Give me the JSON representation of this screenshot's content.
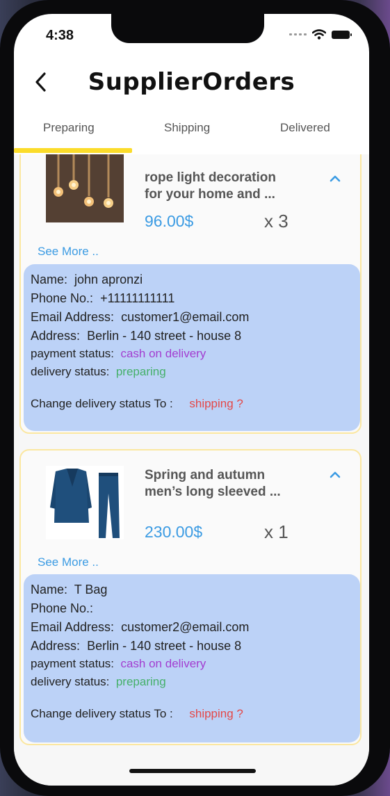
{
  "status_bar": {
    "time": "4:38"
  },
  "header": {
    "title": "SupplierOrders"
  },
  "tabs": [
    {
      "label": "Preparing",
      "active": true
    },
    {
      "label": "Shipping",
      "active": false
    },
    {
      "label": "Delivered",
      "active": false
    }
  ],
  "orders": [
    {
      "product_name": "rope light decoration for your home and ...",
      "name_line1": "rope light decoration",
      "name_line2": "for your home and ...",
      "price": "96.00$",
      "quantity": "x 3",
      "see_more": "See More ..",
      "customer_name_label": "Name:",
      "customer_name": "john apronzi",
      "phone_label": "Phone No.:",
      "phone": "+11111111111",
      "email_label": "Email Address:",
      "email": "customer1@email.com",
      "address_label": "Address:",
      "address": "Berlin - 140 street - house 8",
      "payment_label": "payment status:",
      "payment_status": "cash on delivery",
      "delivery_label": "delivery status:",
      "delivery_status": "preparing",
      "change_label": "Change delivery status To :",
      "change_action": "shipping ?",
      "thumb_icon": "rope-light-image"
    },
    {
      "product_name": "Spring and autumn men's long sleeved ...",
      "name_line1": "Spring and autumn",
      "name_line2": "men’s long sleeved ...",
      "price": "230.00$",
      "quantity": "x 1",
      "see_more": "See More ..",
      "customer_name_label": "Name:",
      "customer_name": "T Bag",
      "phone_label": "Phone No.:",
      "phone": "",
      "email_label": "Email Address:",
      "email": "customer2@email.com",
      "address_label": "Address:",
      "address": "Berlin - 140 street - house 8",
      "payment_label": "payment status:",
      "payment_status": "cash on delivery",
      "delivery_label": "delivery status:",
      "delivery_status": "preparing",
      "change_label": "Change delivery status To :",
      "change_action": "shipping ?",
      "thumb_icon": "suit-image"
    }
  ],
  "colors": {
    "accent_blue": "#3b9be3",
    "tab_indicator": "#fbdc2a",
    "detail_bg": "#bcd2f7",
    "payment": "#a23dd0",
    "delivery": "#45b06a",
    "action": "#e44848"
  }
}
